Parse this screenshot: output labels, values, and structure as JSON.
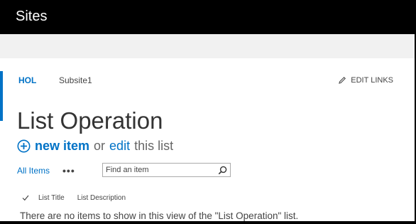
{
  "topbar": {
    "title": "Sites"
  },
  "breadcrumb": {
    "site": "HOL",
    "subsite": "Subsite1"
  },
  "edit_links_label": "EDIT LINKS",
  "page_title": "List Operation",
  "command": {
    "new_item": "new item",
    "or": "or",
    "edit": "edit",
    "this_list": "this list"
  },
  "views": {
    "all_items": "All Items",
    "more": "•••"
  },
  "search": {
    "placeholder": "Find an item"
  },
  "columns": {
    "title": "List Title",
    "description": "List Description"
  },
  "empty_message": "There are no items to show in this view of the \"List Operation\" list.",
  "colors": {
    "accent": "#0072c6",
    "topbar": "#000000",
    "suitebar": "#f1f1f1"
  }
}
